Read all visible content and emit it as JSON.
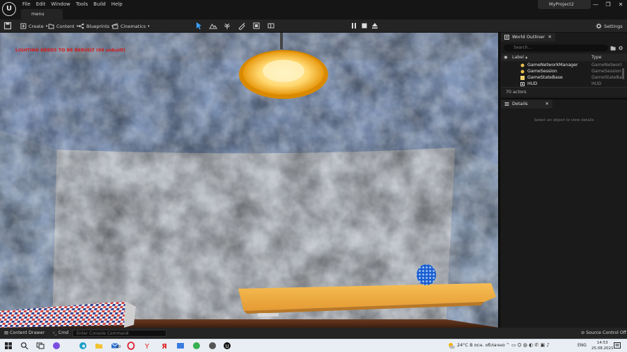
{
  "app": {
    "logo_text": "U",
    "project_name": "MyProject2",
    "level_tab": "menu",
    "menu": [
      "File",
      "Edit",
      "Window",
      "Tools",
      "Build",
      "Help"
    ],
    "window_controls": [
      "—",
      "❐",
      "✕"
    ]
  },
  "toolbar": {
    "create_label": "Create",
    "content_label": "Content",
    "blueprints_label": "Blueprints",
    "cinematics_label": "Cinematics",
    "settings_label": "Settings"
  },
  "viewport": {
    "warning": "LIGHTING NEEDS TO BE REBUILT (69 unbuilt)"
  },
  "outliner": {
    "tab_label": "World Outliner",
    "search_placeholder": "Search...",
    "col_label": "Label ▴",
    "col_type": "Type",
    "rows": [
      {
        "name": "GameNetworkManager",
        "type": "GameNetworkM"
      },
      {
        "name": "GameSession",
        "type": "GameSession"
      },
      {
        "name": "GameStateBase",
        "type": "GameStateBase"
      },
      {
        "name": "HUD",
        "type": "HUD"
      }
    ],
    "actor_count": "70 actors"
  },
  "details": {
    "tab_label": "Details",
    "empty_text": "Select an object to view details"
  },
  "bottombar": {
    "content_drawer": "Content Drawer",
    "cmd_label": "Cmd",
    "console_placeholder": "Enter Console Command",
    "source_control": "Source Control Off"
  },
  "taskbar": {
    "weather": "24°C  В осн. облачно",
    "lang": "ENG",
    "time": "14:53",
    "date": "25.08.2021",
    "badge": "20"
  },
  "colors": {
    "ue_bg": "#151515",
    "panel": "#1a1a1a",
    "toolbar": "#242424",
    "accent_yellow": "#f0c860",
    "warning_red": "#d41a1a"
  }
}
